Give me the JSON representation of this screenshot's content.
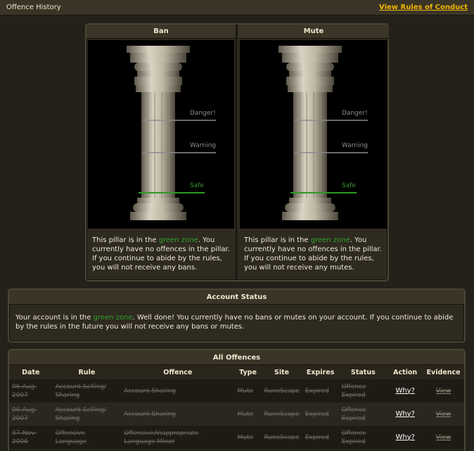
{
  "header": {
    "title": "Offence History",
    "rules_link": "View Rules of Conduct"
  },
  "pillars": [
    {
      "heading": "Ban",
      "zones": {
        "danger": "Danger!",
        "warning": "Warning",
        "safe": "Safe"
      },
      "text_pre": "This pillar is in the ",
      "text_zone": "green zone",
      "text_post": ". You currently have no offences in the pillar. If you continue to abide by the rules, you will not receive any bans."
    },
    {
      "heading": "Mute",
      "zones": {
        "danger": "Danger!",
        "warning": "Warning",
        "safe": "Safe"
      },
      "text_pre": "This pillar is in the ",
      "text_zone": "green zone",
      "text_post": ". You currently have no offences in the pillar. If you continue to abide by the rules, you will not receive any mutes."
    }
  ],
  "account_status": {
    "heading": "Account Status",
    "text_pre": "Your account is in the ",
    "text_zone": "green zone",
    "text_post": ". Well done! You currently have no bans or mutes on your account. If you continue to abide by the rules in the future you will not receive any bans or mutes."
  },
  "offences": {
    "heading": "All Offences",
    "columns": [
      "Date",
      "Rule",
      "Offence",
      "Type",
      "Site",
      "Expires",
      "Status",
      "Action",
      "Evidence"
    ],
    "rows": [
      {
        "date": "06-Aug-2007",
        "rule": "Account Selling/ Sharing",
        "offence": "Account Sharing",
        "type": "Mute",
        "site": "RuneScape",
        "expires": "Expired",
        "status": "Offence Expired",
        "action": "Why?",
        "evidence": "View"
      },
      {
        "date": "06-Aug-2007",
        "rule": "Account Selling/ Sharing",
        "offence": "Account Sharing",
        "type": "Mute",
        "site": "RuneScape",
        "expires": "Expired",
        "status": "Offence Expired",
        "action": "Why?",
        "evidence": "View"
      },
      {
        "date": "07-Nov-2006",
        "rule": "Offensive Language",
        "offence": "Offensive/Inappropriate Language Minor",
        "type": "Mute",
        "site": "RuneScape",
        "expires": "Expired",
        "status": "Offence Expired",
        "action": "Why?",
        "evidence": "View"
      }
    ]
  },
  "colors": {
    "accent_link": "#f0b700",
    "green_zone": "#33a02c",
    "background": "#24211b"
  }
}
